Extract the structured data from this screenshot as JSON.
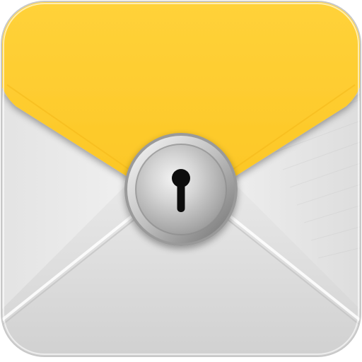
{
  "icon": {
    "name": "locked-mail-app-icon",
    "depicts": [
      "envelope-icon",
      "lock-icon",
      "keyhole-icon"
    ],
    "colors": {
      "flap_yellow": "#FECB2E",
      "flap_yellow_dark": "#F2B818",
      "envelope_light": "#F2F2F2",
      "envelope_mid": "#DADADA",
      "envelope_shadow": "#BDBDBD",
      "lock_silver": "#C9C9C9",
      "lock_dark": "#7E7E7E",
      "keyhole": "#111111",
      "frame_outline": "#C8C8C8"
    }
  }
}
